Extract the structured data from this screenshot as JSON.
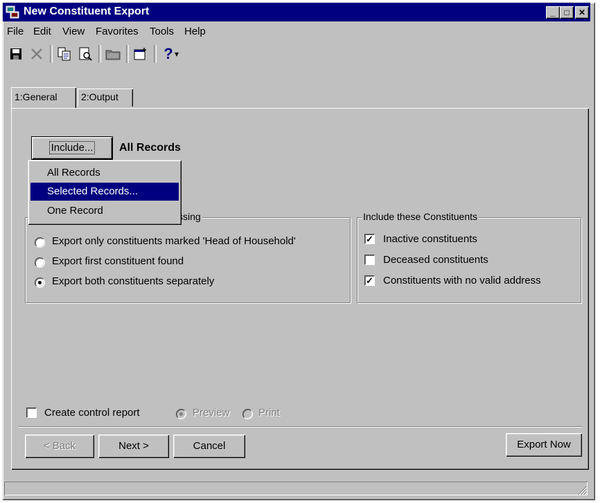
{
  "window": {
    "title": "New Constituent Export",
    "controls": {
      "minimize": "_",
      "maximize": "□",
      "close": "✕"
    }
  },
  "menu": [
    {
      "label": "File"
    },
    {
      "label": "Edit"
    },
    {
      "label": "View"
    },
    {
      "label": "Favorites"
    },
    {
      "label": "Tools"
    },
    {
      "label": "Help"
    }
  ],
  "toolbar": {
    "icons": [
      "save-icon",
      "delete-icon",
      "copy-icon",
      "preview-icon",
      "folder-icon",
      "properties-icon",
      "help-icon"
    ],
    "help_glyph": "?",
    "dropdown_glyph": "▾"
  },
  "tabs": [
    {
      "label": "1:General",
      "active": true
    },
    {
      "label": "2:Output",
      "active": false
    }
  ],
  "include": {
    "button_label": "Include...",
    "current_value": "All Records",
    "menu": [
      {
        "label": "All Records",
        "selected": false
      },
      {
        "label": "Selected Records...",
        "selected": true
      },
      {
        "label": "One Record",
        "selected": false
      }
    ]
  },
  "processing_group": {
    "legend_visible": "ssing",
    "options": [
      {
        "label": "Export only constituents marked 'Head of Household'",
        "checked": false
      },
      {
        "label": "Export first constituent found",
        "checked": false
      },
      {
        "label": "Export both constituents separately",
        "checked": true
      }
    ]
  },
  "include_group": {
    "legend": "Include these Constituents",
    "options": [
      {
        "label": "Inactive constituents",
        "checked": true
      },
      {
        "label": "Deceased constituents",
        "checked": false
      },
      {
        "label": "Constituents with no valid address",
        "checked": true
      }
    ]
  },
  "control_report": {
    "label": "Create control report",
    "checked": false,
    "preview_label": "Preview",
    "print_label": "Print"
  },
  "buttons": {
    "back": "< Back",
    "next": "Next >",
    "cancel": "Cancel",
    "export_now": "Export Now"
  },
  "colors": {
    "face": "#c0c0c0",
    "title_bar": "#000080",
    "selection": "#000080"
  }
}
